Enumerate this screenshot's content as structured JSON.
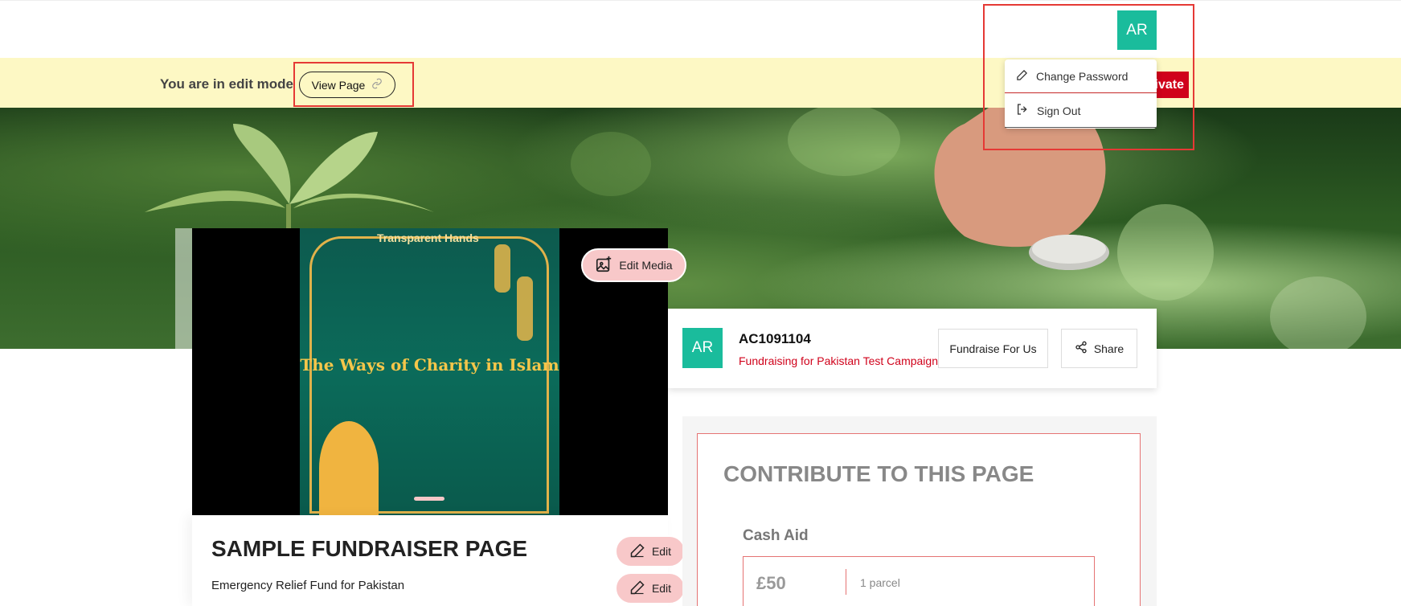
{
  "header": {
    "avatar_initials": "AR"
  },
  "edit_bar": {
    "mode_text": "You are in edit mode",
    "view_page_label": "View Page",
    "private_label": "ivate"
  },
  "user_menu": {
    "items": [
      {
        "label": "Change Password",
        "icon": "pencil-icon"
      },
      {
        "label": "Sign Out",
        "icon": "sign-out-icon"
      }
    ]
  },
  "media": {
    "edit_media_label": "Edit Media",
    "poster_title": "The Ways of Charity in Islam",
    "poster_org": "Transparent Hands"
  },
  "profile": {
    "avatar_initials": "AR",
    "account_id": "AC1091104",
    "subtitle": "Fundraising for Pakistan Test Campaign",
    "fundraise_label": "Fundraise For Us",
    "share_label": "Share"
  },
  "page": {
    "title": "SAMPLE FUNDRAISER PAGE",
    "subtitle": "Emergency Relief Fund for Pakistan",
    "edit_label": "Edit"
  },
  "contribute": {
    "title": "CONTRIBUTE TO THIS PAGE",
    "section_label": "Cash Aid",
    "options": [
      {
        "amount": "£50",
        "description": "1 parcel"
      }
    ]
  },
  "colors": {
    "accent_teal": "#1abc9c",
    "brand_red": "#d0021b",
    "edit_bar_bg": "#fdf8c4",
    "edit_pink": "#f8c8c9"
  }
}
